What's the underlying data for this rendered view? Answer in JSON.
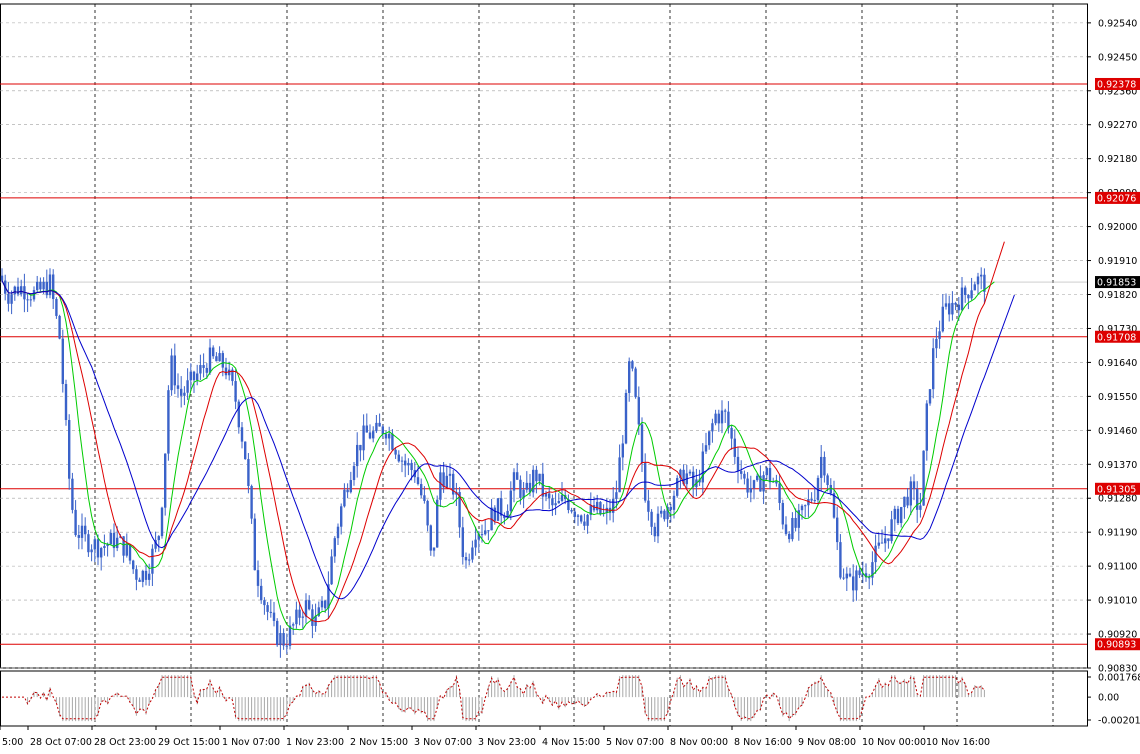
{
  "chart_data": {
    "type": "candlestick",
    "grid": true,
    "colors": {
      "candle": "#3a62c9",
      "ma_fast": "#00cc00",
      "ma_mid": "#dd0000",
      "ma_slow": "#0000cc",
      "hline": "#dd0000",
      "grid": "#a0a0a0",
      "osc": "#c00000",
      "osc_hist": "#a8a8a8"
    },
    "price_axis": {
      "range": [
        0.9083,
        0.9259
      ],
      "ticks": [
        "0.92540",
        "0.92450",
        "0.92360",
        "0.92270",
        "0.92180",
        "0.92090",
        "0.92000",
        "0.91910",
        "0.91820",
        "0.91730",
        "0.91640",
        "0.91550",
        "0.91460",
        "0.91370",
        "0.91280",
        "0.91190",
        "0.91100",
        "0.91010",
        "0.90920",
        "0.90830"
      ]
    },
    "time_axis": {
      "ticks": [
        "5:00",
        "28 Oct 07:00",
        "28 Oct 23:00",
        "29 Oct 15:00",
        "1 Nov 07:00",
        "1 Nov 23:00",
        "2 Nov 15:00",
        "3 Nov 07:00",
        "3 Nov 23:00",
        "4 Nov 15:00",
        "5 Nov 07:00",
        "8 Nov 00:00",
        "8 Nov 16:00",
        "9 Nov 08:00",
        "10 Nov 00:00",
        "10 Nov 16:00"
      ]
    },
    "levels": [
      {
        "value": 0.92378,
        "label": "0.92378"
      },
      {
        "value": 0.92076,
        "label": "0.92076"
      },
      {
        "value": 0.91708,
        "label": "0.91708"
      },
      {
        "value": 0.91305,
        "label": "0.91305"
      },
      {
        "value": 0.90893,
        "label": "0.90893"
      }
    ],
    "current_price": {
      "value": 0.91853,
      "label": "0.91853"
    },
    "price_path": [
      [
        0,
        0.9187
      ],
      [
        8,
        0.9182
      ],
      [
        20,
        0.9184
      ],
      [
        35,
        0.9182
      ],
      [
        50,
        0.9185
      ],
      [
        60,
        0.917
      ],
      [
        65,
        0.915
      ],
      [
        70,
        0.913
      ],
      [
        75,
        0.912
      ],
      [
        85,
        0.9117
      ],
      [
        100,
        0.9115
      ],
      [
        115,
        0.9117
      ],
      [
        125,
        0.9115
      ],
      [
        135,
        0.9108
      ],
      [
        145,
        0.9108
      ],
      [
        155,
        0.9115
      ],
      [
        160,
        0.912
      ],
      [
        165,
        0.914
      ],
      [
        170,
        0.9165
      ],
      [
        175,
        0.916
      ],
      [
        180,
        0.9155
      ],
      [
        195,
        0.916
      ],
      [
        210,
        0.9165
      ],
      [
        225,
        0.9163
      ],
      [
        235,
        0.9155
      ],
      [
        245,
        0.914
      ],
      [
        255,
        0.911
      ],
      [
        265,
        0.91
      ],
      [
        275,
        0.9092
      ],
      [
        285,
        0.909
      ],
      [
        295,
        0.9095
      ],
      [
        305,
        0.91
      ],
      [
        315,
        0.9095
      ],
      [
        325,
        0.91
      ],
      [
        335,
        0.9118
      ],
      [
        345,
        0.913
      ],
      [
        355,
        0.914
      ],
      [
        365,
        0.9145
      ],
      [
        375,
        0.9145
      ],
      [
        385,
        0.9147
      ],
      [
        395,
        0.9142
      ],
      [
        405,
        0.9137
      ],
      [
        415,
        0.9135
      ],
      [
        425,
        0.9125
      ],
      [
        432,
        0.911
      ],
      [
        440,
        0.9135
      ],
      [
        455,
        0.913
      ],
      [
        465,
        0.911
      ],
      [
        475,
        0.912
      ],
      [
        485,
        0.912
      ],
      [
        495,
        0.9125
      ],
      [
        505,
        0.9125
      ],
      [
        515,
        0.9133
      ],
      [
        525,
        0.9128
      ],
      [
        535,
        0.9135
      ],
      [
        545,
        0.9128
      ],
      [
        555,
        0.9125
      ],
      [
        565,
        0.9128
      ],
      [
        575,
        0.9125
      ],
      [
        585,
        0.9123
      ],
      [
        595,
        0.9125
      ],
      [
        605,
        0.9123
      ],
      [
        615,
        0.9127
      ],
      [
        625,
        0.915
      ],
      [
        630,
        0.9165
      ],
      [
        637,
        0.915
      ],
      [
        645,
        0.913
      ],
      [
        655,
        0.912
      ],
      [
        665,
        0.9125
      ],
      [
        675,
        0.913
      ],
      [
        685,
        0.9135
      ],
      [
        695,
        0.913
      ],
      [
        705,
        0.914
      ],
      [
        715,
        0.915
      ],
      [
        725,
        0.915
      ],
      [
        735,
        0.914
      ],
      [
        745,
        0.9132
      ],
      [
        755,
        0.913
      ],
      [
        765,
        0.9135
      ],
      [
        775,
        0.9132
      ],
      [
        785,
        0.912
      ],
      [
        795,
        0.912
      ],
      [
        805,
        0.9125
      ],
      [
        815,
        0.913
      ],
      [
        822,
        0.914
      ],
      [
        830,
        0.913
      ],
      [
        840,
        0.911
      ],
      [
        850,
        0.9105
      ],
      [
        860,
        0.9108
      ],
      [
        870,
        0.911
      ],
      [
        880,
        0.9115
      ],
      [
        890,
        0.912
      ],
      [
        900,
        0.9125
      ],
      [
        910,
        0.913
      ],
      [
        920,
        0.9125
      ],
      [
        928,
        0.9155
      ],
      [
        935,
        0.917
      ],
      [
        945,
        0.9178
      ],
      [
        955,
        0.918
      ],
      [
        965,
        0.9182
      ],
      [
        975,
        0.9186
      ],
      [
        985,
        0.9185
      ]
    ]
  }
}
